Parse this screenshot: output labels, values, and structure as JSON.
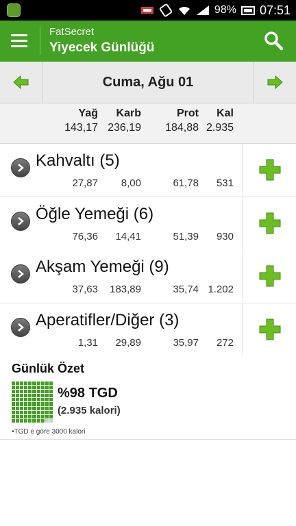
{
  "status_bar": {
    "battery": "98%",
    "time": "07:51"
  },
  "header": {
    "app_name": "FatSecret",
    "title": "Yiyecek Günlüğü"
  },
  "date_nav": {
    "date": "Cuma, Ağu 01"
  },
  "totals": {
    "headers": [
      "Yağ",
      "Karb",
      "Prot",
      "Kal"
    ],
    "values": [
      "143,17",
      "236,19",
      "184,88",
      "2.935"
    ]
  },
  "meals": [
    {
      "title": "Kahvaltı (5)",
      "values": [
        "27,87",
        "8,00",
        "61,78",
        "531"
      ]
    },
    {
      "title": "Öğle Yemeği (6)",
      "values": [
        "76,36",
        "14,41",
        "51,39",
        "930"
      ]
    },
    {
      "title": "Akşam Yemeği (9)",
      "values": [
        "37,63",
        "183,89",
        "35,74",
        "1.202"
      ]
    },
    {
      "title": "Aperatifler/Diğer (3)",
      "values": [
        "1,31",
        "29,89",
        "35,97",
        "272"
      ]
    }
  ],
  "summary": {
    "title": "Günlük Özet",
    "percent_label": "%98 TGD",
    "calories_label": "(2.935 kalori)",
    "note": "•TGD e göre 3000 kalori",
    "percent": 98
  },
  "colors": {
    "accent": "#43a124",
    "plus": "#6cbf23"
  },
  "icons": [
    "menu-icon",
    "search-icon",
    "arrow-left-icon",
    "arrow-right-icon",
    "chevron-right-icon",
    "plus-icon"
  ]
}
